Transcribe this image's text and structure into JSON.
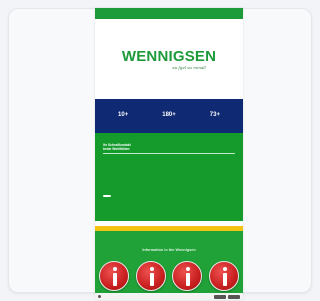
{
  "topbar": {
    "text": ""
  },
  "logo": {
    "name": "WENNIGSEN",
    "tagline": "au fgel su mmall"
  },
  "stats": [
    {
      "value": "10+",
      "label": ""
    },
    {
      "value": "180+",
      "label": ""
    },
    {
      "value": "73+",
      "label": ""
    }
  ],
  "intro": {
    "title_line1": "Ihr Schnellkontakt",
    "title_line2": "beste Wohlfühlen",
    "paragraph1": "",
    "paragraph2": "",
    "button_label": ""
  },
  "info_section": {
    "heading": "Information in the Wennigsen",
    "icons": [
      "info-icon",
      "info-icon",
      "info-icon",
      "info-icon"
    ]
  },
  "cookie_bar": {
    "text": "",
    "accept_label": "",
    "settings_label": ""
  },
  "colors": {
    "primary_green": "#1d9a3a",
    "navy": "#0f2a73",
    "yellow": "#f2c40f",
    "info_red": "#c81f1f"
  }
}
